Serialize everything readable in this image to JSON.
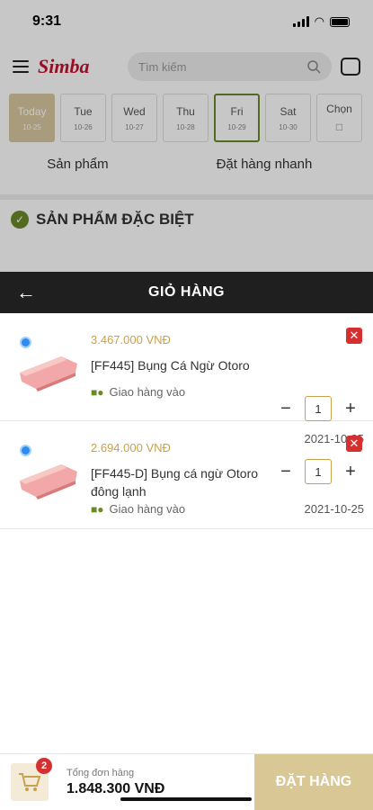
{
  "status": {
    "time": "9:31"
  },
  "header": {
    "logo": "Simba",
    "search_placeholder": "Tìm kiếm"
  },
  "days": [
    {
      "name": "Today",
      "date": "10-25"
    },
    {
      "name": "Tue",
      "date": "10-26"
    },
    {
      "name": "Wed",
      "date": "10-27"
    },
    {
      "name": "Thu",
      "date": "10-28"
    },
    {
      "name": "Fri",
      "date": "10-29"
    },
    {
      "name": "Sat",
      "date": "10-30"
    },
    {
      "name": "Chọn",
      "date": ""
    }
  ],
  "tabs": {
    "products": "Sản phẩm",
    "quick_order": "Đặt hàng nhanh"
  },
  "special": {
    "title": "SẢN PHẨM ĐẶC BIỆT"
  },
  "cart": {
    "title": "GIỎ HÀNG",
    "items": [
      {
        "price": "3.467.000 VNĐ",
        "name": "[FF445] Bụng Cá Ngừ Otoro",
        "ship_label": "Giao hàng vào",
        "date": "2021-10-25",
        "qty": "1"
      },
      {
        "price": "2.694.000 VNĐ",
        "name": "[FF445-D] Bụng cá ngừ Otoro đông lạnh",
        "ship_label": "Giao hàng vào",
        "date": "2021-10-25",
        "qty": "1"
      }
    ]
  },
  "bottom": {
    "total_label": "Tổng đơn hàng",
    "total_value": "1.848.300 VNĐ",
    "cart_count": "2",
    "order_button": "ĐẶT HÀNG"
  },
  "colors": {
    "accent": "#c9a14a",
    "primary_button": "#d9c795",
    "header_bg": "#1f1f1f",
    "delete": "#d62f2f"
  }
}
